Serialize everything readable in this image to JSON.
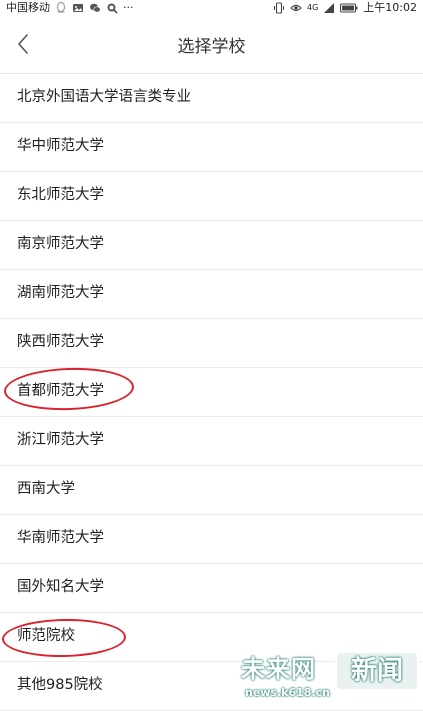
{
  "status_bar": {
    "carrier": "中国移动",
    "more": "···",
    "time": "上午10:02",
    "network": "4G"
  },
  "header": {
    "title": "选择学校"
  },
  "schools": [
    "北京外国语大学语言类专业",
    "华中师范大学",
    "东北师范大学",
    "南京师范大学",
    "湖南师范大学",
    "陕西师范大学",
    "首都师范大学",
    "浙江师范大学",
    "西南大学",
    "华南师范大学",
    "国外知名大学",
    "师范院校",
    "其他985院校"
  ],
  "highlight_color": "#d9232e",
  "watermark": {
    "brand": "未来网",
    "tag": "新闻",
    "url": "news.k618.cn"
  }
}
